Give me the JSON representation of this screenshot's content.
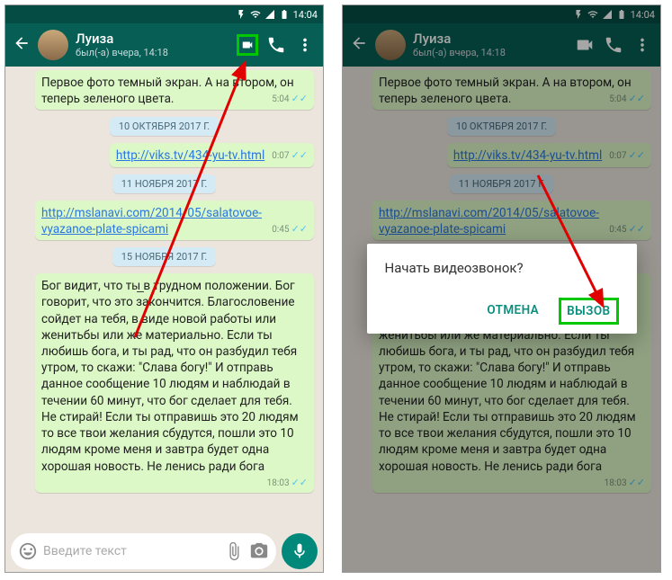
{
  "statusBar": {
    "time": "14:04"
  },
  "contact": {
    "name": "Луиза",
    "status": "был(-а) вчера, 14:18"
  },
  "chat": {
    "msg1": {
      "text": "Первое фото темный экран. А на втором, он теперь зеленого цвета.",
      "time": "5:04"
    },
    "date1": "10 ОКТЯБРЯ 2017 Г.",
    "link1": {
      "url": "http://viks.tv/434-yu-tv.html",
      "time": "0:07"
    },
    "date2": "11 НОЯБРЯ 2017 Г.",
    "link2": {
      "url": "http://mslanavi.com/2014/05/salatovoe-vyazanoe-plate-spicami",
      "time": "0:45"
    },
    "date3": "15 НОЯБРЯ 2017 Г.",
    "msg2": {
      "text": "Бог видит, что ты̲ в трудном положении. Бог говорит,  что это закончится. Благословение сойдет на тебя, в виде новой работы или женитьбы или же материально. Если ты любишь бога,  и ты рад, что он разбудил тебя утром, то скажи: \"Слава богу!\"  И отправь данное сообщение 10 людям и наблюдай в течении 60 минут, что бог сделает для тебя. Не стирай! Если ты отправишь это 20 людям то все твои желания сбудутся, пошли это 10 людям кроме меня и завтра будет одна хорошая новость. Не ленись ради бога",
      "time": "18:03"
    }
  },
  "input": {
    "placeholder": "Введите текст"
  },
  "dialog": {
    "title": "Начать видеозвонок?",
    "cancel": "ОТМЕНА",
    "call": "ВЫЗОВ"
  }
}
